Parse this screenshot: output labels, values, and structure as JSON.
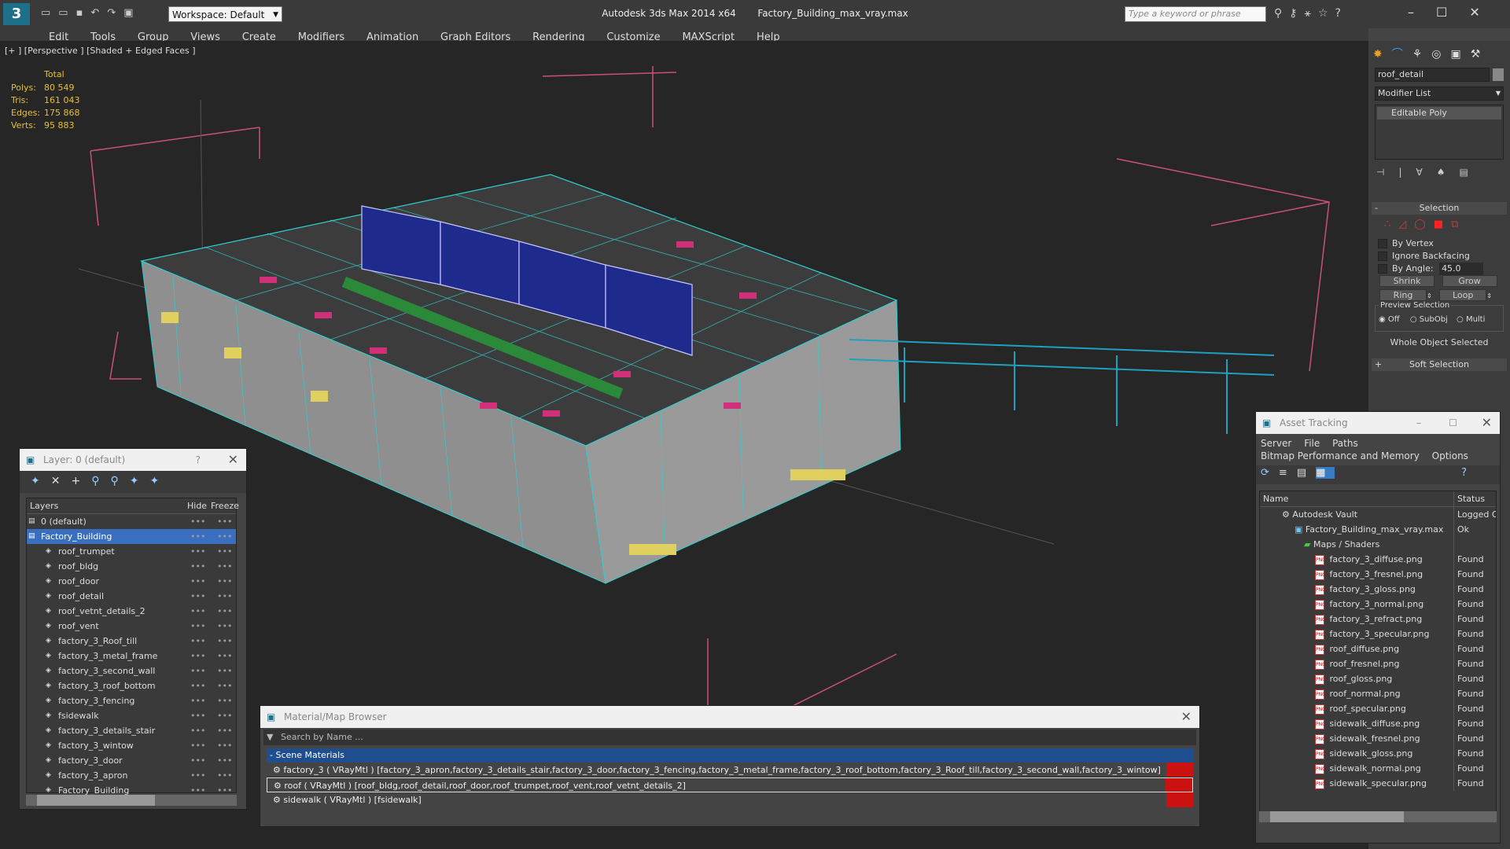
{
  "title": {
    "app": "Autodesk 3ds Max  2014 x64",
    "file": "Factory_Building_max_vray.max",
    "workspace": "Workspace: Default",
    "search_placeholder": "Type a keyword or phrase"
  },
  "menu": [
    "Edit",
    "Tools",
    "Group",
    "Views",
    "Create",
    "Modifiers",
    "Animation",
    "Graph Editors",
    "Rendering",
    "Customize",
    "MAXScript",
    "Help"
  ],
  "viewport": {
    "label": "[+ ] [Perspective ] [Shaded + Edged Faces ]",
    "stats_header": "Total",
    "stats": [
      {
        "k": "Polys:",
        "v": "80 549"
      },
      {
        "k": "Tris:",
        "v": "161 043"
      },
      {
        "k": "Edges:",
        "v": "175 868"
      },
      {
        "k": "Verts:",
        "v": "95 883"
      }
    ]
  },
  "command_panel": {
    "object_name": "roof_detail",
    "modifier_list": "Modifier List",
    "stack_item": "Editable Poly",
    "selection_title": "Selection",
    "by_vertex": "By Vertex",
    "ignore_backfacing": "Ignore Backfacing",
    "by_angle": "By Angle:",
    "angle_value": "45.0",
    "shrink": "Shrink",
    "grow": "Grow",
    "ring": "Ring",
    "loop": "Loop",
    "preview_selection": "Preview Selection",
    "off": "Off",
    "subobj": "SubObj",
    "multi": "Multi",
    "whole_object": "Whole Object Selected",
    "soft_selection": "Soft Selection"
  },
  "layer_window": {
    "title": "Layer: 0 (default)",
    "col_layers": "Layers",
    "col_hide": "Hide",
    "col_freeze": "Freeze",
    "items": [
      "0 (default)",
      "Factory_Building",
      "roof_trumpet",
      "roof_bldg",
      "roof_door",
      "roof_detail",
      "roof_vetnt_details_2",
      "roof_vent",
      "factory_3_Roof_till",
      "factory_3_metal_frame",
      "factory_3_second_wall",
      "factory_3_roof_bottom",
      "factory_3_fencing",
      "fsidewalk",
      "factory_3_details_stair",
      "factory_3_wintow",
      "factory_3_door",
      "factory_3_apron",
      "Factory_Building"
    ]
  },
  "material_browser": {
    "title": "Material/Map Browser",
    "search_placeholder": "Search by Name ...",
    "section": "Scene Materials",
    "items": [
      "factory_3  ( VRayMtl ) [factory_3_apron,factory_3_details_stair,factory_3_door,factory_3_fencing,factory_3_metal_frame,factory_3_roof_bottom,factory_3_Roof_till,factory_3_second_wall,factory_3_wintow]",
      "roof  ( VRayMtl ) [roof_bldg,roof_detail,roof_door,roof_trumpet,roof_vent,roof_vetnt_details_2]",
      "sidewalk  ( VRayMtl ) [fsidewalk]"
    ]
  },
  "asset_tracking": {
    "title": "Asset Tracking",
    "menu": [
      "Server",
      "File",
      "Paths"
    ],
    "menu2": [
      "Bitmap Performance and Memory",
      "Options"
    ],
    "col_name": "Name",
    "col_status": "Status",
    "rows": [
      {
        "name": "Autodesk Vault",
        "status": "Logged O"
      },
      {
        "name": "Factory_Building_max_vray.max",
        "status": "Ok"
      },
      {
        "name": "Maps / Shaders",
        "status": ""
      },
      {
        "name": "factory_3_diffuse.png",
        "status": "Found"
      },
      {
        "name": "factory_3_fresnel.png",
        "status": "Found"
      },
      {
        "name": "factory_3_gloss.png",
        "status": "Found"
      },
      {
        "name": "factory_3_normal.png",
        "status": "Found"
      },
      {
        "name": "factory_3_refract.png",
        "status": "Found"
      },
      {
        "name": "factory_3_specular.png",
        "status": "Found"
      },
      {
        "name": "roof_diffuse.png",
        "status": "Found"
      },
      {
        "name": "roof_fresnel.png",
        "status": "Found"
      },
      {
        "name": "roof_gloss.png",
        "status": "Found"
      },
      {
        "name": "roof_normal.png",
        "status": "Found"
      },
      {
        "name": "roof_specular.png",
        "status": "Found"
      },
      {
        "name": "sidewalk_diffuse.png",
        "status": "Found"
      },
      {
        "name": "sidewalk_fresnel.png",
        "status": "Found"
      },
      {
        "name": "sidewalk_gloss.png",
        "status": "Found"
      },
      {
        "name": "sidewalk_normal.png",
        "status": "Found"
      },
      {
        "name": "sidewalk_specular.png",
        "status": "Found"
      }
    ]
  }
}
